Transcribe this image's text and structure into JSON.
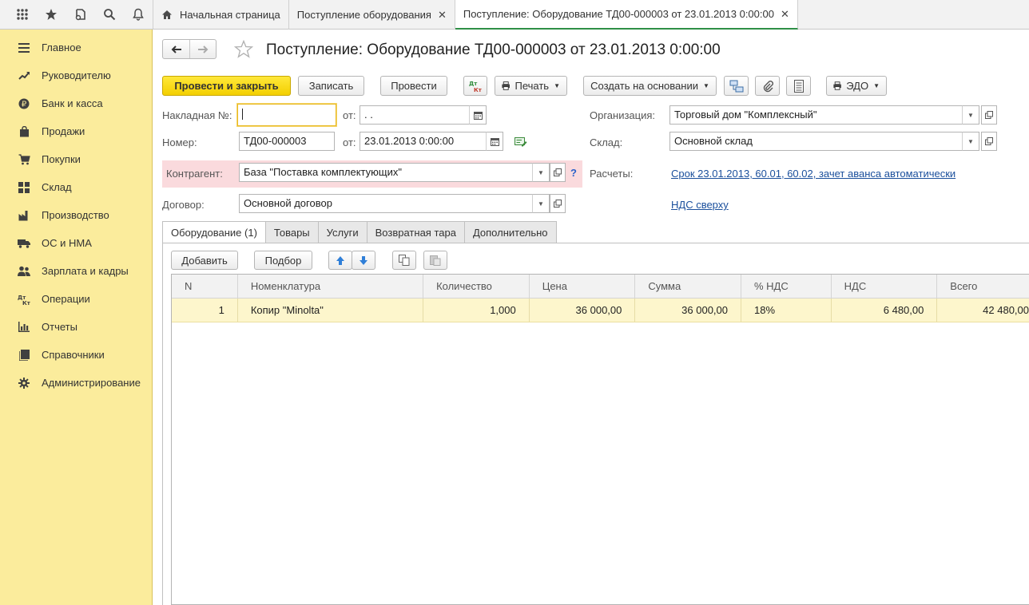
{
  "topbar": {
    "icons": [
      "apps-grid-icon",
      "favorites-star-icon",
      "history-icon",
      "search-icon",
      "notifications-bell-icon"
    ],
    "tabs": [
      {
        "label": "Начальная страница",
        "home": true
      },
      {
        "label": "Поступление оборудования",
        "closable": true
      },
      {
        "label": "Поступление: Оборудование ТД00-000003 от 23.01.2013 0:00:00",
        "closable": true,
        "active": true
      }
    ],
    "close_glyph": "✕"
  },
  "sidebar": {
    "items": [
      {
        "label": "Главное",
        "icon": "menu-lines-icon"
      },
      {
        "label": "Руководителю",
        "icon": "trend-chart-icon"
      },
      {
        "label": "Банк и касса",
        "icon": "ruble-coin-icon"
      },
      {
        "label": "Продажи",
        "icon": "shopping-bag-icon"
      },
      {
        "label": "Покупки",
        "icon": "cart-icon"
      },
      {
        "label": "Склад",
        "icon": "warehouse-grid-icon"
      },
      {
        "label": "Производство",
        "icon": "factory-icon"
      },
      {
        "label": "ОС и НМА",
        "icon": "truck-icon"
      },
      {
        "label": "Зарплата и кадры",
        "icon": "people-icon"
      },
      {
        "label": "Операции",
        "icon": "debit-credit-icon"
      },
      {
        "label": "Отчеты",
        "icon": "bar-chart-icon"
      },
      {
        "label": "Справочники",
        "icon": "book-icon"
      },
      {
        "label": "Администрирование",
        "icon": "gear-icon"
      }
    ]
  },
  "document": {
    "title": "Поступление: Оборудование ТД00-000003 от 23.01.2013 0:00:00"
  },
  "toolbar": {
    "post_close": "Провести и закрыть",
    "save": "Записать",
    "post": "Провести",
    "dtkt": "Дт Кт",
    "print": "Печать",
    "create_based": "Создать на основании",
    "edo": "ЭДО"
  },
  "form": {
    "invoice_label": "Накладная  №:",
    "invoice_value": "",
    "from_label": "от:",
    "invoice_date": "  .  .",
    "number_label": "Номер:",
    "number_value": "ТД00-000003",
    "from_label2": "от:",
    "doc_date": "23.01.2013  0:00:00",
    "org_label": "Организация:",
    "org_value": "Торговый дом \"Комплексный\"",
    "warehouse_label": "Склад:",
    "warehouse_value": "Основной склад",
    "contractor_label": "Контрагент:",
    "contractor_value": "База \"Поставка комплектующих\"",
    "help_glyph": "?",
    "settlements_label": "Расчеты:",
    "settlements_link": "Срок 23.01.2013, 60.01, 60.02, зачет аванса автоматически",
    "contract_label": "Договор:",
    "contract_value": "Основной договор",
    "vat_link": "НДС сверху"
  },
  "tabs": [
    {
      "label": "Оборудование (1)",
      "active": true
    },
    {
      "label": "Товары"
    },
    {
      "label": "Услуги"
    },
    {
      "label": "Возвратная тара"
    },
    {
      "label": "Дополнительно"
    }
  ],
  "table_toolbar": {
    "add": "Добавить",
    "pick": "Подбор"
  },
  "table": {
    "columns": [
      "N",
      "Номенклатура",
      "Количество",
      "Цена",
      "Сумма",
      "% НДС",
      "НДС",
      "Всего"
    ],
    "rows": [
      [
        "1",
        "Копир \"Minolta\"",
        "1,000",
        "36 000,00",
        "36 000,00",
        "18%",
        "6 480,00",
        "42 480,00"
      ]
    ]
  },
  "colors": {
    "sidebar_bg": "#fbec9c",
    "primary_button": "#f3cf00",
    "link": "#1a4f9c",
    "selected_row": "#fdf6cc",
    "required_highlight": "#fadadd",
    "active_tab_underline": "#2f8f46"
  }
}
